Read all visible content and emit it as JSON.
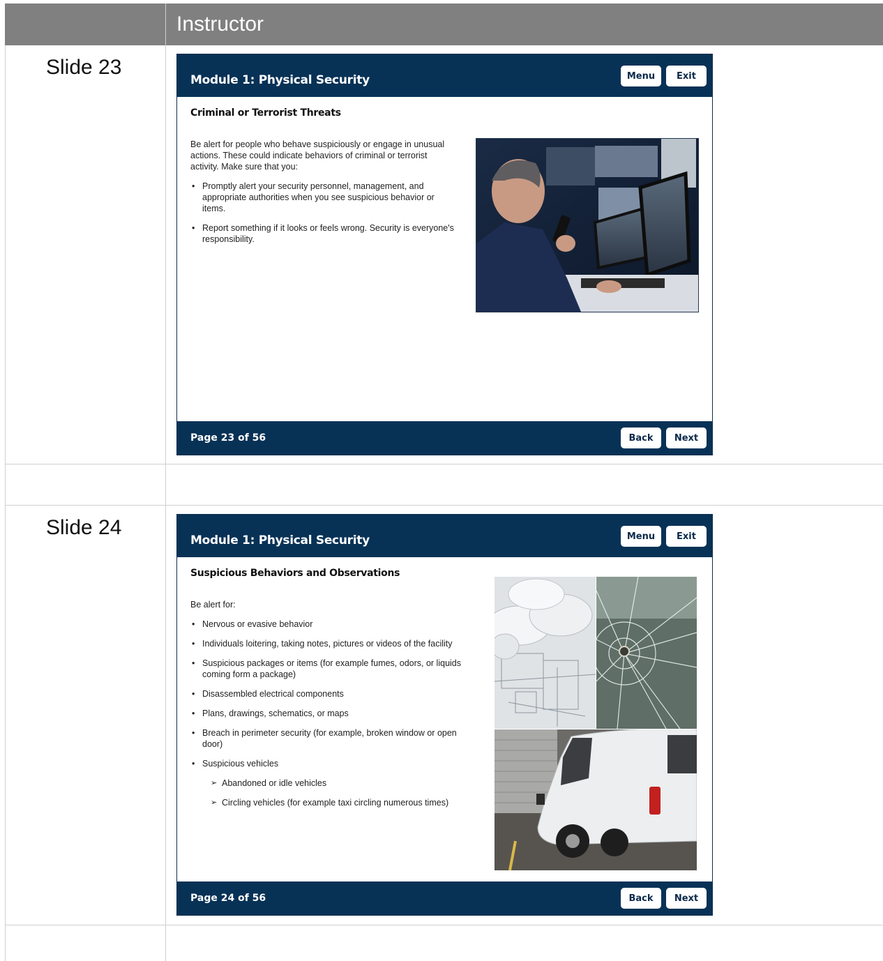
{
  "table": {
    "header": "Instructor"
  },
  "slides": [
    {
      "label": "Slide 23",
      "module_title": "Module 1: Physical Security",
      "menu_label": "Menu",
      "exit_label": "Exit",
      "heading": "Criminal or Terrorist Threats",
      "intro": "Be alert for people who behave suspiciously or engage in unusual actions. These could indicate behaviors of criminal or terrorist activity. Make sure that you:",
      "bullets": [
        "Promptly alert your security personnel, management, and appropriate authorities when you see suspicious behavior or items.",
        "Report something if it looks or feels wrong. Security is everyone's responsibility."
      ],
      "page": "Page 23 of 56",
      "back_label": "Back",
      "next_label": "Next"
    },
    {
      "label": "Slide 24",
      "module_title": "Module 1: Physical Security",
      "menu_label": "Menu",
      "exit_label": "Exit",
      "heading": "Suspicious Behaviors and Observations",
      "intro": "Be alert for:",
      "bullets": [
        "Nervous or evasive behavior",
        "Individuals loitering, taking notes, pictures or videos of the facility",
        "Suspicious packages or items (for example fumes, odors, or liquids coming form a package)",
        "Disassembled electrical components",
        "Plans, drawings, schematics, or maps",
        "Breach in perimeter security (for example, broken window or open door)",
        "Suspicious vehicles"
      ],
      "sub_bullets": [
        "Abandoned or idle vehicles",
        "Circling vehicles (for example taxi circling numerous times)"
      ],
      "page": "Page 24 of 56",
      "back_label": "Back",
      "next_label": "Next"
    }
  ]
}
